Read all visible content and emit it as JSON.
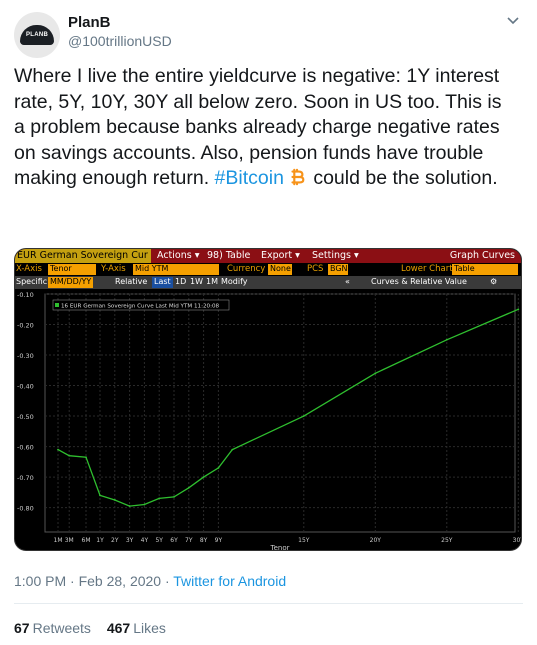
{
  "tweet": {
    "name": "PlanB",
    "handle": "@100trillionUSD",
    "avatar_text": "PLANB",
    "text_before": "Where I live the entire yieldcurve is negative: 1Y interest rate, 5Y, 10Y, 30Y all below zero. Soon in US too. This is a problem because banks already charge negative rates on savings accounts. Also, pension funds have trouble making enough return. ",
    "hashtag": "#Bitcoin",
    "text_after": " could be the solution.",
    "timestamp": "1:00 PM · Feb 28, 2020 · ",
    "source": "Twitter for Android",
    "retweets_count": "67",
    "retweets_label": "Retweets",
    "likes_count": "467",
    "likes_label": "Likes",
    "icons": {
      "caret": "chevron-down-icon",
      "bitcoin": "bitcoin-icon"
    },
    "colors": {
      "link": "#1b95e0",
      "muted": "#657786",
      "bitcoin": "#f7931a"
    }
  },
  "terminal": {
    "title": "EUR German Sovereign Cur",
    "menu": [
      "Actions ▾",
      "98) Table",
      "Export ▾",
      "Settings ▾"
    ],
    "graph_curves": "Graph Curves",
    "xaxis_label": "X-Axis",
    "xaxis_value": "Tenor",
    "yaxis_label": "Y-Axis",
    "yaxis_value": "Mid YTM",
    "currency_label": "Currency",
    "currency_value": "None",
    "pcs_label": "PCS",
    "pcs_value": "BGN",
    "lower_chart_label": "Lower Chart",
    "lower_chart_value": "Table",
    "specific_label": "Specific",
    "date_value": "MM/DD/YY",
    "relative_label": "Relative",
    "last_label": "Last",
    "periods": [
      "1D",
      "1W",
      "1M"
    ],
    "modify_label": "Modify",
    "collapse_label": "«",
    "curves_label": "Curves & Relative Value",
    "gear_icon": "gear-icon"
  },
  "chart_data": {
    "type": "line",
    "legend": "16 EUR German Sovereign Curve Last Mid YTM 11:20:08",
    "xlabel": "Tenor",
    "ylabel": "",
    "x_tick_labels": [
      "1M",
      "3M",
      "6M",
      "1Y",
      "2Y",
      "3Y",
      "4Y",
      "5Y",
      "6Y",
      "7Y",
      "8Y",
      "9Y",
      "15Y",
      "20Y",
      "25Y",
      "30Y"
    ],
    "y_tick_labels": [
      "-0.10",
      "-0.20",
      "-0.30",
      "-0.40",
      "-0.50",
      "-0.60",
      "-0.70",
      "-0.80"
    ],
    "ylim": [
      -0.88,
      -0.1
    ],
    "grid": true,
    "series": [
      {
        "color": "#2fbf2f",
        "x": [
          "1M",
          "3M",
          "6M",
          "1Y",
          "2Y",
          "3Y",
          "4Y",
          "5Y",
          "6Y",
          "7Y",
          "8Y",
          "9Y",
          "10Y",
          "15Y",
          "20Y",
          "25Y",
          "30Y"
        ],
        "values": [
          -0.61,
          -0.63,
          -0.635,
          -0.76,
          -0.775,
          -0.795,
          -0.79,
          -0.77,
          -0.765,
          -0.735,
          -0.7,
          -0.67,
          -0.61,
          -0.5,
          -0.36,
          -0.25,
          -0.15
        ]
      }
    ]
  }
}
